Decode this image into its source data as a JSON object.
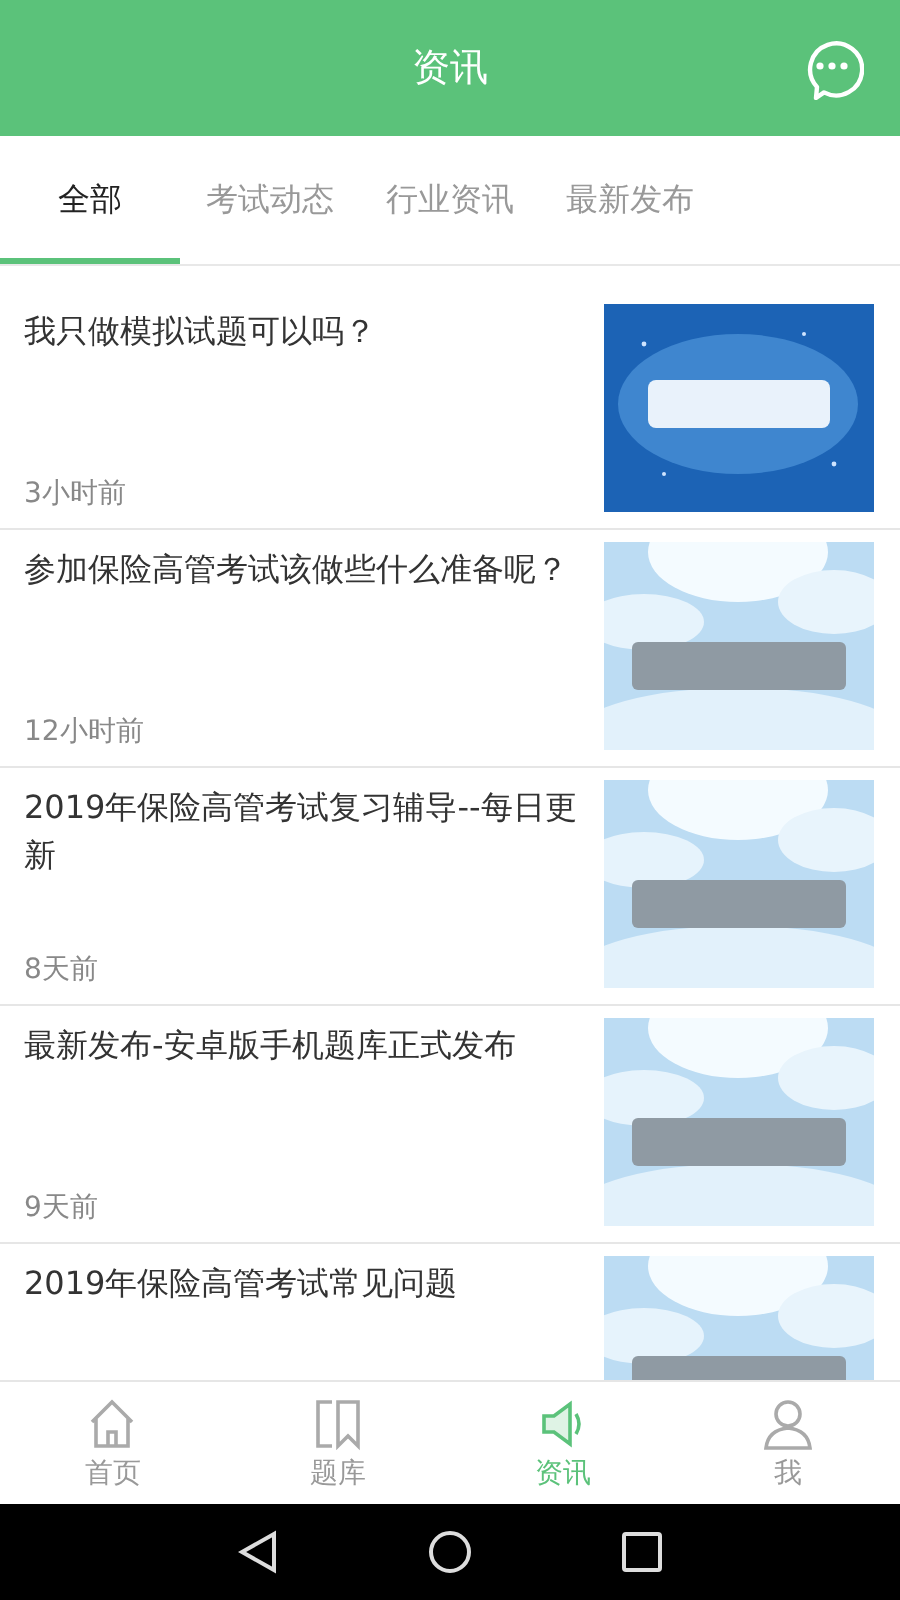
{
  "header": {
    "title": "资讯"
  },
  "tabs": [
    {
      "label": "全部",
      "selected": true
    },
    {
      "label": "考试动态",
      "selected": false
    },
    {
      "label": "行业资讯",
      "selected": false
    },
    {
      "label": "最新发布",
      "selected": false
    }
  ],
  "articles": [
    {
      "title": "我只做模拟试题可以吗？",
      "time": "3小时前"
    },
    {
      "title": "参加保险高管考试该做些什么准备呢？",
      "time": "12小时前"
    },
    {
      "title": "2019年保险高管考试复习辅导--每日更新",
      "time": "8天前"
    },
    {
      "title": "最新发布-安卓版手机题库正式发布",
      "time": "9天前"
    },
    {
      "title": "2019年保险高管考试常见问题"
    }
  ],
  "bottom_nav": [
    {
      "label": "首页",
      "selected": false
    },
    {
      "label": "题库",
      "selected": false
    },
    {
      "label": "资讯",
      "selected": true
    },
    {
      "label": "我",
      "selected": false
    }
  ]
}
